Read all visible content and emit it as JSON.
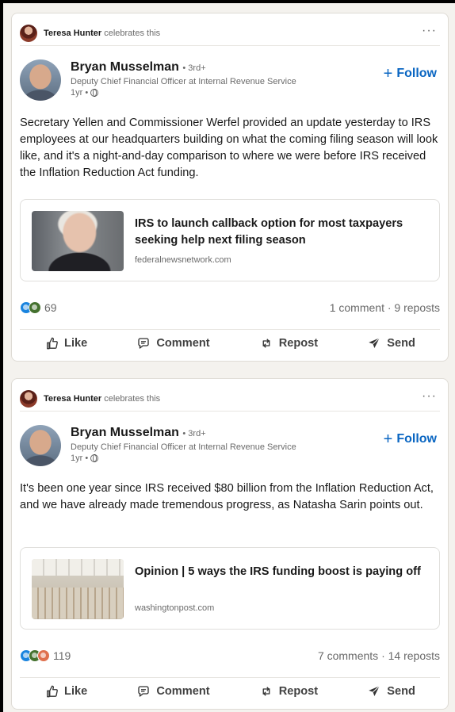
{
  "posts": [
    {
      "activity": {
        "actor": "Teresa Hunter",
        "action": "celebrates this"
      },
      "author": {
        "name": "Bryan Musselman",
        "degree": "• 3rd+",
        "headline": "Deputy Chief Financial Officer at Internal Revenue Service",
        "time": "1yr •"
      },
      "follow_label": "Follow",
      "text": "Secretary Yellen and Commissioner Werfel provided an update yesterday to IRS employees at our headquarters building on what the coming filing season will look like, and it's a night-and-day comparison to where we were before IRS received the Inflation Reduction Act funding.",
      "link": {
        "title": "IRS to launch callback option for most taxpayers seeking help next filing season",
        "source": "federalnewsnetwork.com"
      },
      "reactions": {
        "count": "69",
        "types": [
          "clap-icon",
          "support-icon"
        ]
      },
      "counts": "1 comment · 9 reposts"
    },
    {
      "activity": {
        "actor": "Teresa Hunter",
        "action": "celebrates this"
      },
      "author": {
        "name": "Bryan Musselman",
        "degree": "• 3rd+",
        "headline": "Deputy Chief Financial Officer at Internal Revenue Service",
        "time": "1yr •"
      },
      "follow_label": "Follow",
      "text": "It's been one year since IRS received $80 billion from the Inflation Reduction Act, and we have already made tremendous progress, as Natasha Sarin points out.",
      "link": {
        "title": "Opinion | 5 ways the IRS funding boost is paying off",
        "source": "washingtonpost.com"
      },
      "reactions": {
        "count": "119",
        "types": [
          "clap-icon",
          "support-icon",
          "love-icon"
        ]
      },
      "counts": "7 comments · 14 reposts"
    }
  ],
  "actions": {
    "like": "Like",
    "comment": "Comment",
    "repost": "Repost",
    "send": "Send"
  },
  "colors": {
    "accent": "#0a66c2",
    "background": "#f4f2ee",
    "card": "#ffffff"
  }
}
